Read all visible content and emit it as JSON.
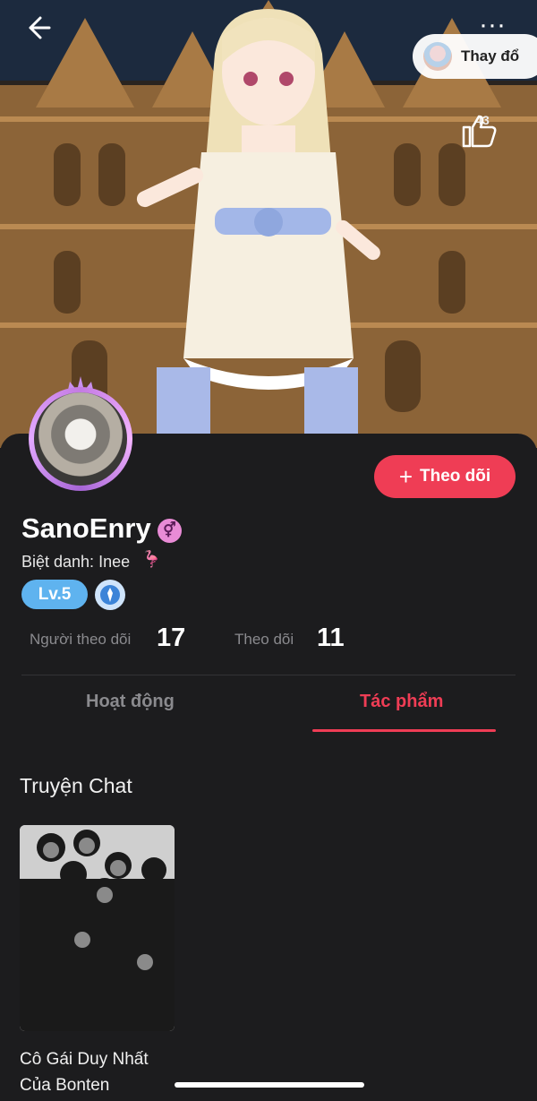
{
  "header": {
    "change_label": "Thay đổ",
    "like_count": "43",
    "more_label": "···"
  },
  "profile": {
    "username": "SanoEnry",
    "gender_symbol": "⚥",
    "nickname_label": "Biệt danh: Inee",
    "nickname_emoji": "🦩",
    "level": "Lv.5",
    "follow_button": "Theo dõi",
    "follow_plus": "+",
    "stats": {
      "followers_label": "Người theo dõi",
      "followers_value": "17",
      "following_label": "Theo dõi",
      "following_value": "11"
    }
  },
  "tabs": {
    "activity": "Hoạt động",
    "works": "Tác phẩm",
    "active": "works"
  },
  "works": {
    "section_title": "Truyện Chat",
    "items": [
      {
        "title": "Cô Gái Duy Nhất Của Bonten"
      }
    ]
  },
  "colors": {
    "accent": "#ef3d55",
    "background": "#1c1c1e",
    "level_badge": "#5fb3ef",
    "gender_badge": "#e98bd6"
  },
  "icons": [
    "arrow-left-icon",
    "more-icon",
    "thumbs-up-icon",
    "plus-icon",
    "female-icon",
    "rank-icon"
  ]
}
